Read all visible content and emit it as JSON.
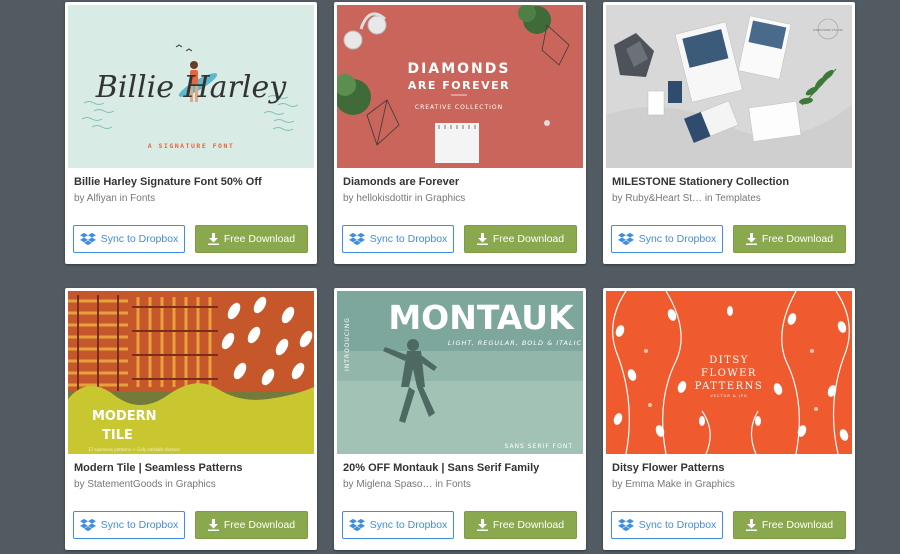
{
  "colors": {
    "background": "#525a62",
    "dropbox_blue": "#3d8ee0",
    "download_green": "#8aa84d"
  },
  "buttons": {
    "sync_label": "Sync to Dropbox",
    "download_label": "Free Download"
  },
  "icons": {
    "sync": "dropbox-icon",
    "download": "download-arrow-icon"
  },
  "cards": [
    {
      "title": "Billie Harley Signature Font 50% Off",
      "author": "Alfiyan",
      "in_word": "in",
      "category": "Fonts",
      "thumb": {
        "line1": "Billie Harley",
        "line2": "A SIGNATURE FONT"
      }
    },
    {
      "title": "Diamonds are Forever",
      "author": "hellokisdottir",
      "in_word": "in",
      "category": "Graphics",
      "thumb": {
        "line1": "DIAMONDS",
        "line2": "ARE FOREVER",
        "line3": "CREATIVE COLLECTION"
      }
    },
    {
      "title": "MILESTONE Stationery Collection",
      "author": "Ruby&Heart St…",
      "in_word": "in",
      "category": "Templates",
      "thumb": {
        "line1": "MILESTONE STUDIO"
      }
    },
    {
      "title": "Modern Tile | Seamless Patterns",
      "author": "StatementGoods",
      "in_word": "in",
      "category": "Graphics",
      "thumb": {
        "line1": "MODERN",
        "line2": "TILE",
        "line3": "17 seamless patterns + Fully editable Vectors"
      }
    },
    {
      "title": "20% OFF Montauk | Sans Serif Family",
      "author": "Miglena Spaso…",
      "in_word": "in",
      "category": "Fonts",
      "thumb": {
        "line1": "MONTAUK",
        "line2": "LIGHT, REGULAR, BOLD & ITALIC",
        "line3": "SANS SERIF FONT",
        "line4": "INTRODUCING"
      }
    },
    {
      "title": "Ditsy Flower Patterns",
      "author": "Emma Make",
      "in_word": "in",
      "category": "Graphics",
      "thumb": {
        "line1": "DITSY",
        "line2": "FLOWER",
        "line3": "PATTERNS",
        "line4": "VECTOR & JPG"
      }
    }
  ]
}
